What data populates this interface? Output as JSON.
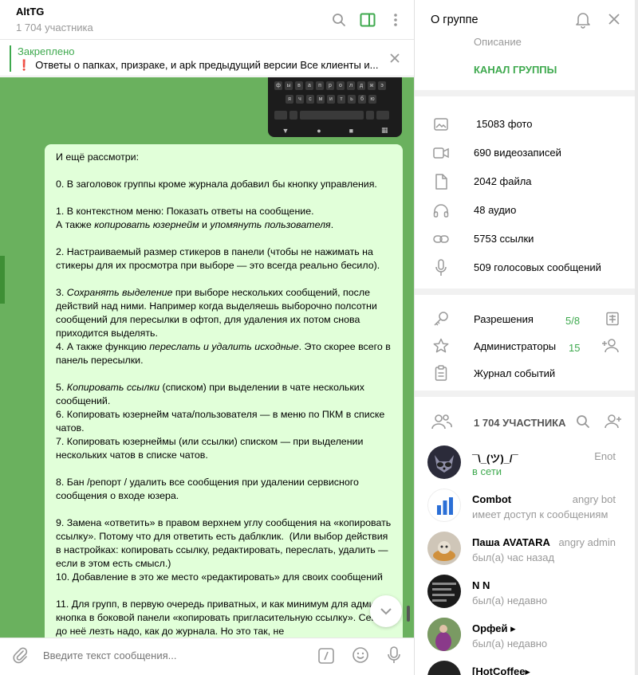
{
  "chat": {
    "title": "AltTG",
    "subtitle": "1 704 участника",
    "pinned": {
      "title": "Закреплено",
      "text": "Ответы о папках, призраке, и apk предыдущий версии  Все клиенты и..."
    },
    "keyboard_rows": [
      [
        "ф",
        "ы",
        "в",
        "а",
        "п",
        "р",
        "о",
        "л",
        "д",
        "ж",
        "э"
      ],
      [
        "я",
        "ч",
        "с",
        "м",
        "и",
        "т",
        "ь",
        "б",
        "ю"
      ]
    ],
    "message": [
      {
        "t": "И ещё рассмотри:"
      },
      {
        "t": ""
      },
      {
        "t": "0. В заголовок группы кроме журнала добавил бы кнопку управления."
      },
      {
        "t": ""
      },
      {
        "t": "1. В контекстном меню: Показать ответы на сообщение."
      },
      {
        "parts": [
          {
            "t": "А также "
          },
          {
            "t": "копировать юзернейм",
            "i": true
          },
          {
            "t": " и "
          },
          {
            "t": "упомянуть пользователя",
            "i": true
          },
          {
            "t": "."
          }
        ]
      },
      {
        "t": ""
      },
      {
        "t": "2. Настраиваемый размер стикеров в панели (чтобы не нажимать на стикеры для их просмотра при выборе — это всегда реально бесило)."
      },
      {
        "t": ""
      },
      {
        "parts": [
          {
            "t": "3. "
          },
          {
            "t": "Сохранять выделение",
            "i": true
          },
          {
            "t": " при выборе нескольких сообщений, после действий над ними. Например когда выделяешь выборочно полсотни сообщений для пересылки в офтоп, для удаления их потом снова приходится выделять."
          }
        ]
      },
      {
        "parts": [
          {
            "t": "4. А также функцию "
          },
          {
            "t": "переслать и удалить исходные",
            "i": true
          },
          {
            "t": ". Это скорее всего в панель пересылки."
          }
        ]
      },
      {
        "t": ""
      },
      {
        "parts": [
          {
            "t": "5. "
          },
          {
            "t": "Копировать ссылки",
            "i": true
          },
          {
            "t": " (списком) при выделении в чате нескольких сообщений."
          }
        ]
      },
      {
        "t": "6. Копировать юзернейм чата/пользователя — в меню по ПКМ в списке чатов."
      },
      {
        "t": "7. Копировать юзернеймы (или ссылки) списком — при выделении нескольких чатов в списке чатов."
      },
      {
        "t": ""
      },
      {
        "t": "8. Бан /репорт / удалить все сообщения при удалении сервисного сообщения о входе юзера."
      },
      {
        "t": ""
      },
      {
        "t": "9. Замена «ответить» в правом верхнем углу сообщения на «копировать ссылку». Потому что для ответить есть даблклик.  (Или выбор действия в настройках: копировать ссылку, редактировать, переслать, удалить — если в этом есть смысл.)"
      },
      {
        "t": "10. Добавление в это же место «редактировать» для своих сообщений"
      },
      {
        "t": ""
      },
      {
        "t": "11. Для групп, в первую очередь приватных, и как минимум для админов: кнопка в боковой панели «копировать пригласительную ссылку». Сейчас до неё лезть надо, как до журнала. Но это так, не"
      }
    ],
    "composer_placeholder": "Введите текст сообщения..."
  },
  "info": {
    "title": "О группе",
    "description_label": "Описание",
    "channel_link": "КАНАЛ ГРУППЫ",
    "media": [
      {
        "icon": "photo-icon",
        "label": "15083 фото"
      },
      {
        "icon": "video-icon",
        "label": "690 видеозаписей"
      },
      {
        "icon": "file-icon",
        "label": "2042 файла"
      },
      {
        "icon": "headphones-icon",
        "label": "48 аудио"
      },
      {
        "icon": "link-icon",
        "label": "5753 ссылки"
      },
      {
        "icon": "mic-icon",
        "label": "509 голосовых сообщений"
      }
    ],
    "admin": [
      {
        "icon": "key-icon",
        "label": "Разрешения",
        "count": "5/8"
      },
      {
        "icon": "star-icon",
        "label": "Администраторы",
        "count": "15"
      },
      {
        "icon": "journal-icon",
        "label": "Журнал событий",
        "count": ""
      }
    ],
    "members_header": "1 704 УЧАСТНИКА",
    "members": [
      {
        "name": "¯\\_(ツ)_/¯",
        "status": "в сети",
        "online": true,
        "role": "Enot",
        "avatar": "#2b2b3a"
      },
      {
        "name": "Combot",
        "status": "имеет доступ к сообщениям",
        "online": false,
        "role": "angry bot",
        "avatar": "#ffffff"
      },
      {
        "name": "Паша AVATARA",
        "status": "был(а) час назад",
        "online": false,
        "role": "angry admin",
        "avatar": "#cfc6b8"
      },
      {
        "name": "N N",
        "status": "был(а) недавно",
        "online": false,
        "role": "",
        "avatar": "#1a1a1a"
      },
      {
        "name": "Орфей ▸",
        "status": "был(а) недавно",
        "online": false,
        "role": "",
        "avatar": "#6e8f5a"
      },
      {
        "name": "[HotCoffee▸",
        "status": "",
        "online": false,
        "role": "",
        "avatar": "#222"
      }
    ]
  },
  "colors": {
    "accent": "#3ea94e",
    "chat_bg": "#6ab15e",
    "bubble": "#e1ffd9"
  }
}
